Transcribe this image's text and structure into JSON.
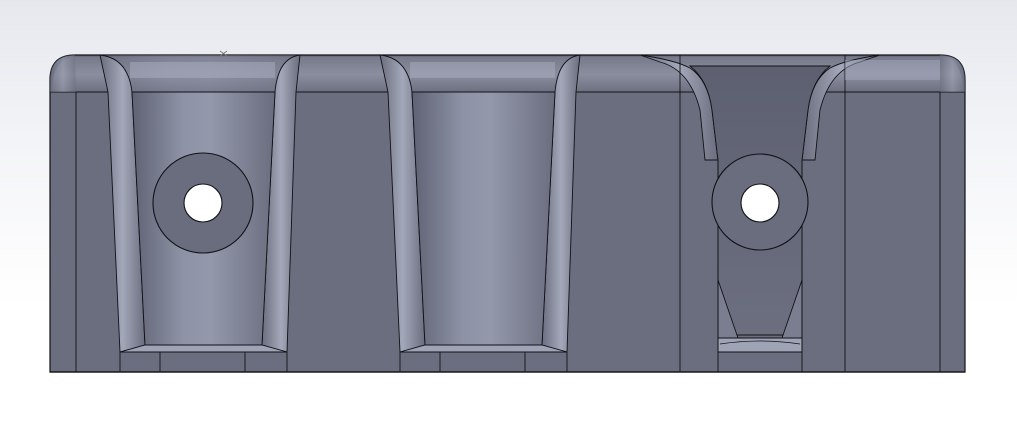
{
  "viewport": {
    "background_top": "#e6e8ee",
    "background_bottom": "#ffffff"
  },
  "model": {
    "body_color": "#6b6e7e",
    "highlight_color": "#9ea3b5",
    "edge_color": "#111216",
    "hole_color": "#ffffff",
    "pockets": 3,
    "mounting_holes": 2
  }
}
